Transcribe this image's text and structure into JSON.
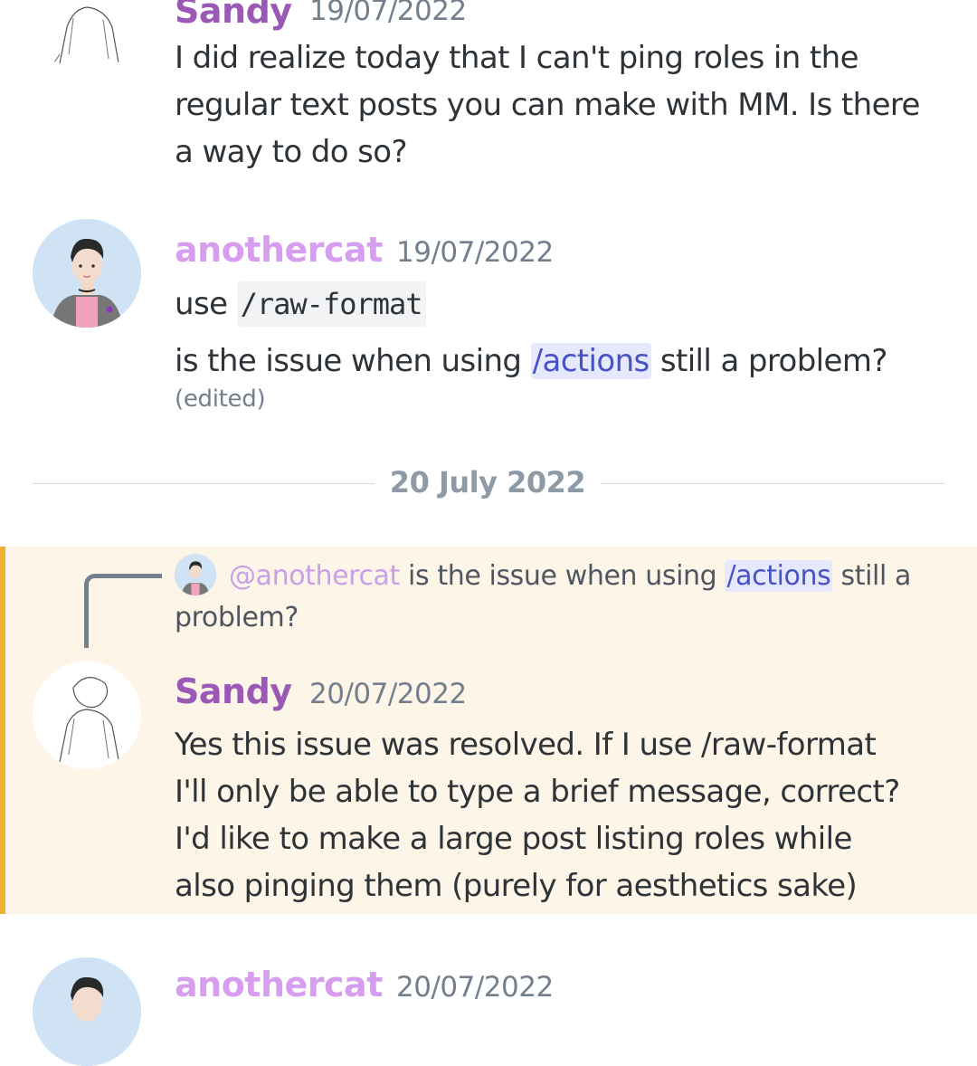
{
  "colors": {
    "sandy_name": "#9b59b6",
    "anothercat_name": "#d79ef0",
    "timestamp": "#747f8d",
    "command_text": "#4752c4",
    "command_bg": "#e6e8fd",
    "highlight_bg": "#fdf5e8",
    "highlight_bar": "#f0b232"
  },
  "messages": [
    {
      "author": "Sandy",
      "timestamp": "19/07/2022",
      "avatar_icon": "sketch-avatar-icon",
      "text": "I did realize today that I can't ping roles in the regular text posts you can make with MM. Is there a way to do so?"
    },
    {
      "author": "anothercat",
      "timestamp": "19/07/2022",
      "avatar_icon": "person-avatar-icon",
      "line1_prefix": "use ",
      "line1_code": "/raw-format",
      "line2_prefix": "is the issue when using ",
      "line2_command": "/actions",
      "line2_suffix": " still a problem?",
      "edited": "(edited)"
    }
  ],
  "date_divider": "20 July 2022",
  "reply": {
    "mention": "@anothercat",
    "text_before": "is the issue when using ",
    "command": "/actions",
    "text_after_line1": " still a",
    "text_line2": "problem?"
  },
  "reply_message": {
    "author": "Sandy",
    "timestamp": "20/07/2022",
    "lines": [
      "Yes this issue was resolved. If I use /raw-format",
      "I'll only be able to type a brief message, correct?",
      "I'd like to make a large post listing roles while",
      "also pinging them (purely for aesthetics sake)"
    ]
  },
  "next_message": {
    "author": "anothercat",
    "timestamp": "20/07/2022"
  }
}
